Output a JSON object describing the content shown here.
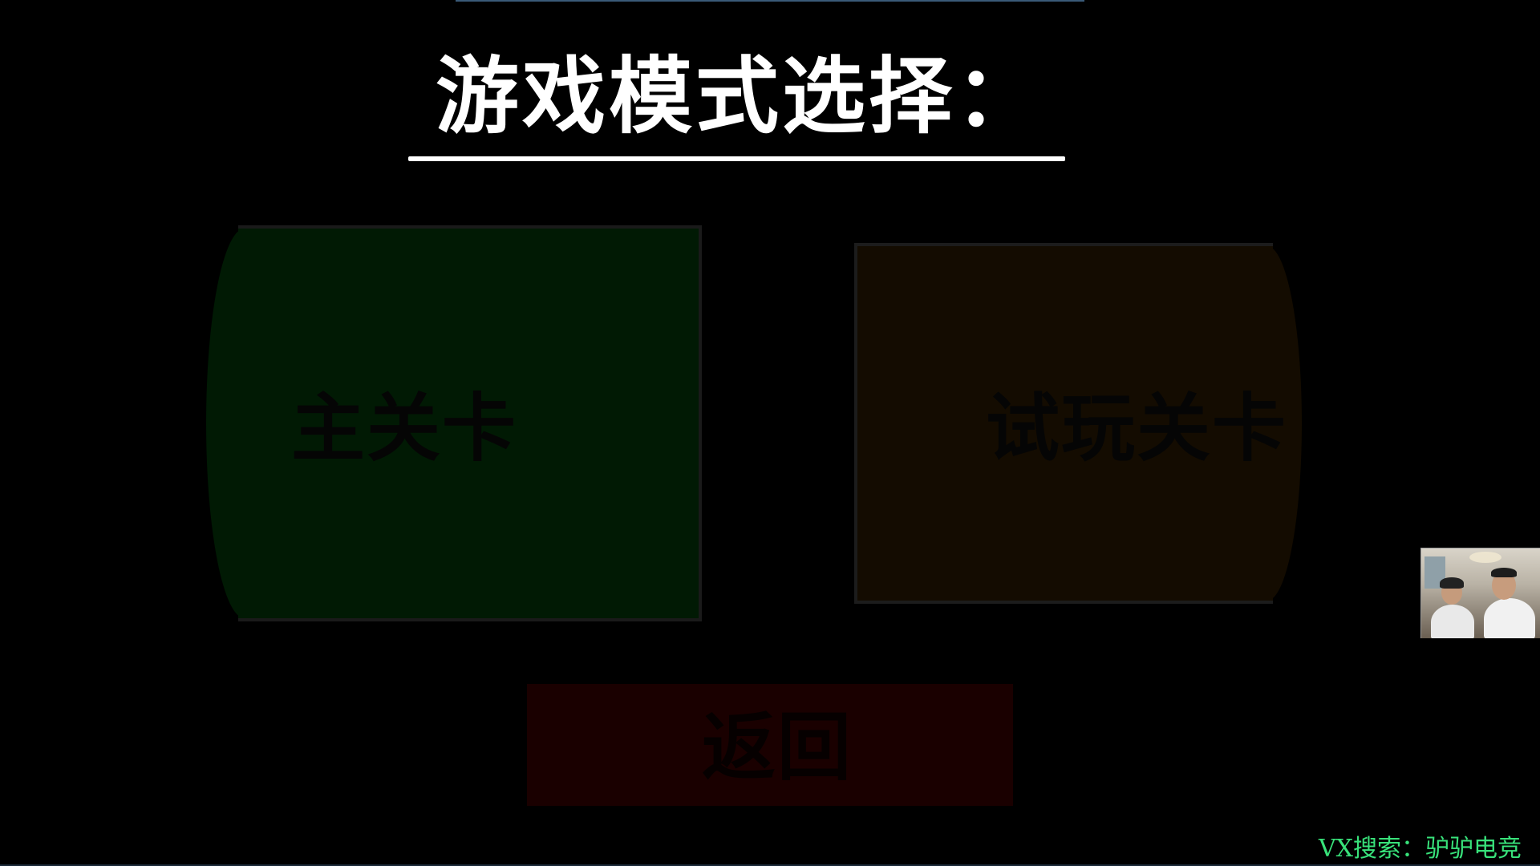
{
  "title": "游戏模式选择：",
  "modes": {
    "main": {
      "label": "主关卡",
      "color": "#011a04"
    },
    "trial": {
      "label": "试玩关卡",
      "color": "#140c01"
    }
  },
  "back_button": {
    "label": "返回",
    "color": "#1a0000"
  },
  "overlay": {
    "watermark": "VX搜索：驴驴电竞",
    "watermark_color": "#38e27a"
  }
}
